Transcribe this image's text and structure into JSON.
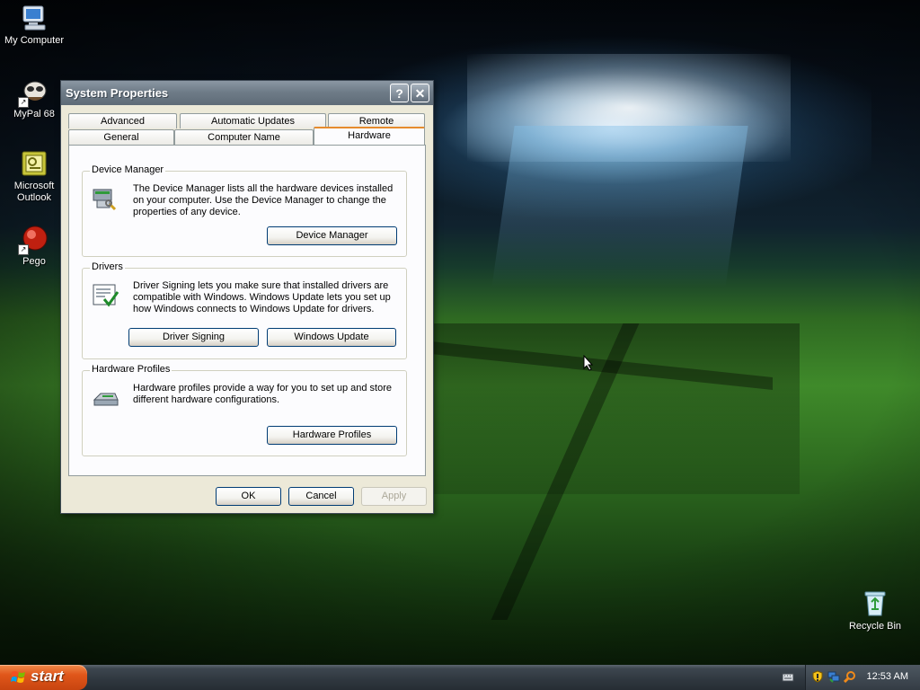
{
  "desktop": {
    "icons": [
      {
        "label": "My Computer",
        "icon": "my-computer-icon"
      },
      {
        "label": "MyPal 68",
        "icon": "mypal-browser-icon"
      },
      {
        "label": "Microsoft Outlook",
        "icon": "outlook-icon"
      },
      {
        "label": "Pego",
        "icon": "pego-icon"
      },
      {
        "label": "Recycle Bin",
        "icon": "recycle-bin-icon"
      }
    ]
  },
  "dialog": {
    "title": "System Properties",
    "help_button": "?",
    "close_button": "✕",
    "tabs_row1": [
      "Advanced",
      "Automatic Updates",
      "Remote"
    ],
    "tabs_row2": [
      "General",
      "Computer Name",
      "Hardware"
    ],
    "active_tab": "Hardware",
    "device_manager": {
      "legend": "Device Manager",
      "description": "The Device Manager lists all the hardware devices installed on your computer. Use the Device Manager to change the properties of any device.",
      "button": "Device Manager"
    },
    "drivers": {
      "legend": "Drivers",
      "description": "Driver Signing lets you make sure that installed drivers are compatible with Windows. Windows Update lets you set up how Windows connects to Windows Update for drivers.",
      "button_signing": "Driver Signing",
      "button_update": "Windows Update"
    },
    "hardware_profiles": {
      "legend": "Hardware Profiles",
      "description": "Hardware profiles provide a way for you to set up and store different hardware configurations.",
      "button": "Hardware Profiles"
    },
    "footer": {
      "ok": "OK",
      "cancel": "Cancel",
      "apply": "Apply"
    }
  },
  "taskbar": {
    "start_label": "start",
    "clock": "12:53 AM"
  },
  "colors": {
    "tab_active_accent": "#e68b2c",
    "start_button": "#e0561a",
    "dialog_face": "#ece9d8"
  }
}
